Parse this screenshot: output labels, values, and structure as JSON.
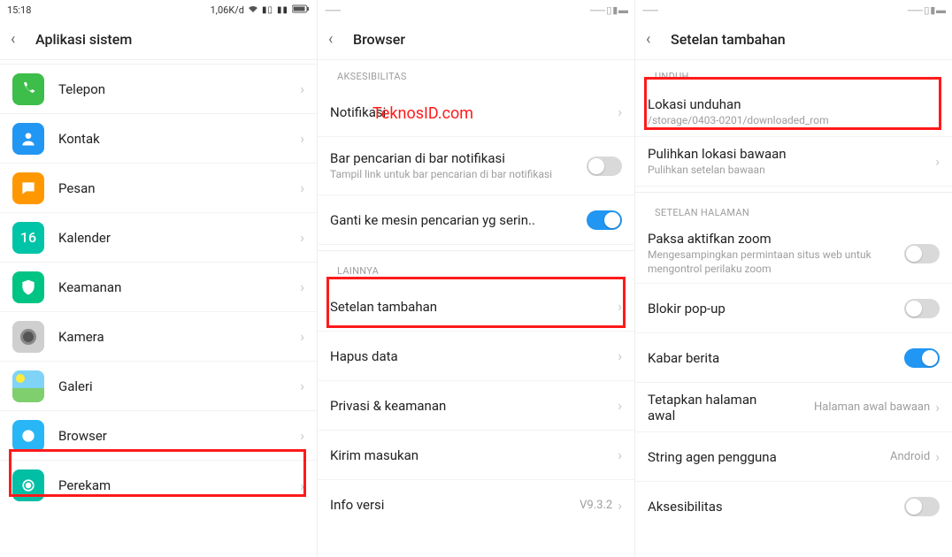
{
  "watermark": "TeknosID.com",
  "p1": {
    "time": "15:18",
    "net": "1,06K/d",
    "title": "Aplikasi sistem",
    "items": [
      {
        "label": "Telepon"
      },
      {
        "label": "Kontak"
      },
      {
        "label": "Pesan"
      },
      {
        "label": "Kalender",
        "iconText": "16"
      },
      {
        "label": "Keamanan"
      },
      {
        "label": "Kamera"
      },
      {
        "label": "Galeri"
      },
      {
        "label": "Browser"
      },
      {
        "label": "Perekam"
      }
    ]
  },
  "p2": {
    "title": "Browser",
    "section1": "AKSESIBILITAS",
    "notif": "Notifikasi",
    "searchbar": "Bar pencarian di bar notifikasi",
    "searchbar_sub": "Tampil link untuk bar pencarian di bar notifikasi",
    "engine": "Ganti ke mesin pencarian yg serin..",
    "section2": "LAINNYA",
    "advanced": "Setelan tambahan",
    "clear": "Hapus data",
    "privacy": "Privasi & keamanan",
    "feedback": "Kirim masukan",
    "version": "Info versi",
    "version_val": "V9.3.2"
  },
  "p3": {
    "title": "Setelan tambahan",
    "section1": "UNDUH",
    "loc": "Lokasi unduhan",
    "loc_sub": "/storage/0403-0201/downloaded_rom",
    "restore": "Pulihkan lokasi bawaan",
    "restore_sub": "Pulihkan setelan bawaan",
    "section2": "SETELAN HALAMAN",
    "zoom": "Paksa aktifkan zoom",
    "zoom_sub": "Mengesampingkan permintaan situs web untuk mengontrol perilaku zoom",
    "popup": "Blokir pop-up",
    "news": "Kabar berita",
    "homepage": "Tetapkan halaman awal",
    "homepage_val": "Halaman awal bawaan",
    "ua": "String agen pengguna",
    "ua_val": "Android",
    "a11y": "Aksesibilitas"
  }
}
